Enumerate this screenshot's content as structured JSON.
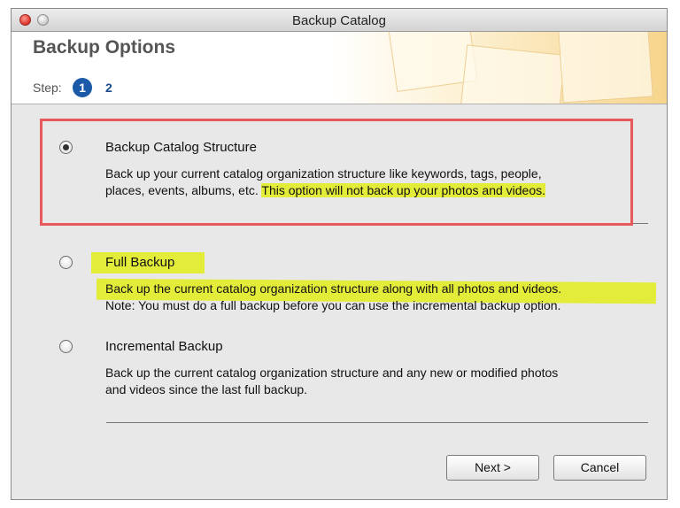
{
  "window": {
    "title": "Backup Catalog"
  },
  "header": {
    "title": "Backup Options",
    "step_label": "Step:",
    "steps": [
      "1",
      "2"
    ]
  },
  "options": [
    {
      "title": "Backup Catalog Structure",
      "description_line1": "Back up your current catalog organization structure like keywords, tags, people,",
      "description_line2_plain": "places, events, albums, etc. ",
      "description_line2_highlight": "This option will not back up your photos and videos.",
      "selected": true
    },
    {
      "title": "Full Backup",
      "description_line1": "Back up the current catalog organization structure along with all photos and videos.",
      "description_line2": "Note: You must do a full backup before you can use the incremental backup option.",
      "selected": false
    },
    {
      "title": "Incremental Backup",
      "description_line1": "Back up the current catalog organization structure and any new or modified photos",
      "description_line2": "and videos since the last full backup.",
      "selected": false
    }
  ],
  "buttons": {
    "next": "Next >",
    "cancel": "Cancel"
  },
  "colors": {
    "highlight": "#e4ec3a",
    "annotation_frame": "#e85a5a",
    "step_badge": "#1a5aa8"
  }
}
